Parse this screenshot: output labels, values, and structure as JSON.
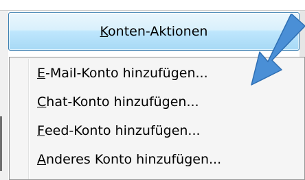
{
  "actions_button": {
    "accel": "K",
    "rest": "onten-Aktionen"
  },
  "menu": {
    "items": [
      {
        "accel": "E",
        "rest": "-Mail-Konto hinzufügen..."
      },
      {
        "accel": "C",
        "rest": "hat-Konto hinzufügen..."
      },
      {
        "accel": "F",
        "rest": "eed-Konto hinzufügen..."
      },
      {
        "accel": "A",
        "rest": "nderes Konto hinzufügen..."
      }
    ]
  },
  "annotation": {
    "icon": "arrow-icon",
    "color": "#4a8fd6"
  },
  "colors": {
    "button_border": "#3c7fb1",
    "menu_background": "#f5f5f5",
    "menu_border": "#979797"
  }
}
